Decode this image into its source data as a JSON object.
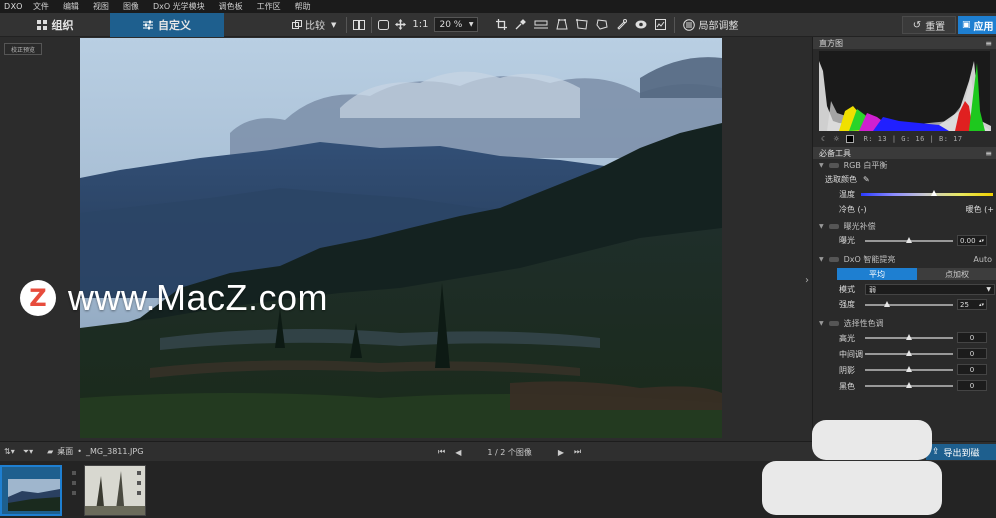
{
  "menu": {
    "logo": "DXO",
    "items": [
      "文件",
      "编辑",
      "视图",
      "图像",
      "DxO 光学模块",
      "调色板",
      "工作区",
      "帮助"
    ]
  },
  "toolbar": {
    "tab_organize": "组织",
    "tab_customize": "自定义",
    "compare_label": "比较",
    "one_to_one": "1:1",
    "zoom_value": "20 %",
    "local_adjust": "局部调整",
    "reset": "重置",
    "apply": "应用"
  },
  "viewer": {
    "before_after": "校正预览"
  },
  "watermark": {
    "logo_letter": "Z",
    "text": "www.MacZ.com"
  },
  "histogram": {
    "title": "直方图",
    "readout": "R:  13  |  G:  16  |  B:  17"
  },
  "tools": {
    "title": "必备工具",
    "white_balance": {
      "title": "RGB 白平衡",
      "picker": "选取颜色",
      "temperature": "温度",
      "cool": "冷色 (-)",
      "warm": "暖色 (+",
      "temp_level": 0.55
    },
    "exposure": {
      "title": "曝光补偿",
      "label": "曝光",
      "value": "0.00",
      "level": 0.5
    },
    "smart_lighting": {
      "title": "DxO 智能提亮",
      "auto": "Auto",
      "mode_uniform": "平均",
      "mode_spot": "点加权",
      "mode_label": "模式",
      "mode_value": "弱",
      "strength_label": "强度",
      "strength_value": "25",
      "level": 0.25
    },
    "selective_tone": {
      "title": "选择性色调",
      "rows": [
        {
          "label": "高光",
          "value": "0"
        },
        {
          "label": "中间调",
          "value": "0"
        },
        {
          "label": "阴影",
          "value": "0"
        },
        {
          "label": "黑色",
          "value": "0"
        }
      ]
    }
  },
  "filmbar": {
    "folder": "桌面",
    "filename": "_MG_3811.JPG",
    "pager": "1 / 2  个图像",
    "export": "导出到磁"
  },
  "colors": {
    "accent": "#1e7fd1",
    "tab_active": "#1e5f8e",
    "panel": "#2a2a2a"
  }
}
